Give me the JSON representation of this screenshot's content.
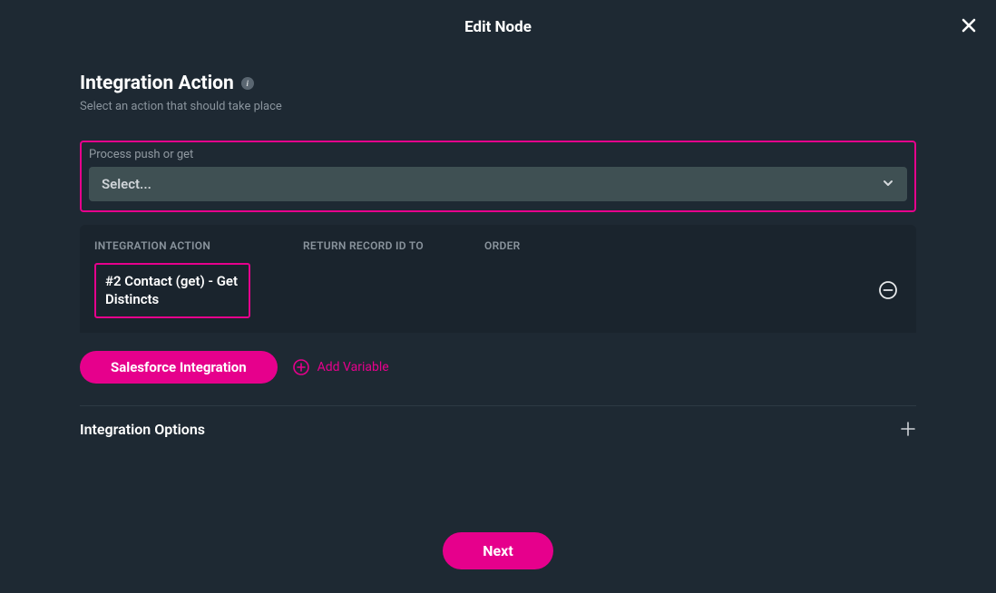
{
  "modal": {
    "title": "Edit Node"
  },
  "section": {
    "title": "Integration Action",
    "info_badge": "i",
    "subtitle": "Select an action that should take place"
  },
  "process": {
    "label": "Process push or get",
    "placeholder": "Select..."
  },
  "table": {
    "headers": {
      "action": "INTEGRATION ACTION",
      "return_to": "RETURN RECORD ID TO",
      "order": "ORDER"
    },
    "rows": [
      {
        "action": "#2 Contact (get) - Get Distincts",
        "return_to": "",
        "order": ""
      }
    ]
  },
  "actions": {
    "salesforce_label": "Salesforce Integration",
    "add_variable_label": "Add Variable"
  },
  "options": {
    "label": "Integration Options"
  },
  "footer": {
    "next_label": "Next"
  }
}
